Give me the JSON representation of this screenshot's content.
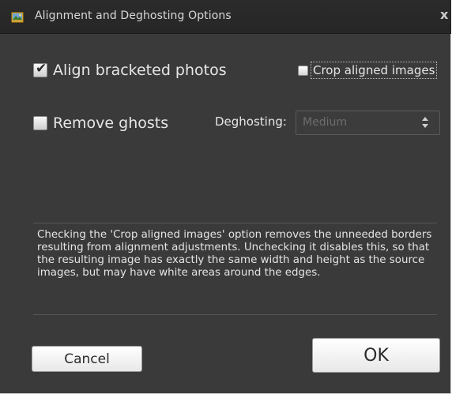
{
  "window": {
    "title": "Alignment and Deghosting Options",
    "close_glyph": "x"
  },
  "options": {
    "align": {
      "label": "Align bracketed photos",
      "checked": true
    },
    "crop": {
      "label": "Crop aligned images",
      "checked": false
    },
    "ghosts": {
      "label": "Remove ghosts",
      "checked": false
    },
    "deghosting": {
      "label": "Deghosting:",
      "value": "Medium",
      "enabled": false
    }
  },
  "info_text": "Checking the 'Crop aligned images' option removes the unneeded borders resulting from alignment adjustments. Unchecking it disables this, so that the resulting image has exactly the same width and height as the source images, but may have white areas around the edges.",
  "buttons": {
    "cancel": "Cancel",
    "ok": "OK"
  },
  "icons": {
    "app": "photo-app-icon",
    "close": "close-icon",
    "check": "checkmark-icon",
    "select_arrows": "up-down-arrows-icon"
  },
  "colors": {
    "dialog_bg": "#3a3a3a",
    "titlebar_bg": "#282828",
    "text": "#e6e6e6",
    "disabled_text": "#6d6d6d"
  }
}
